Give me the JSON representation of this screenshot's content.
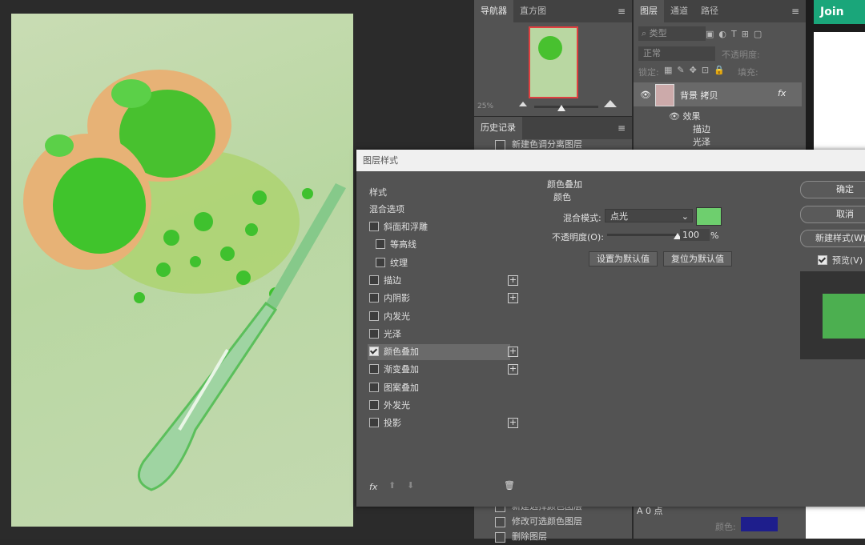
{
  "navigator": {
    "tabs": [
      "导航器",
      "直方图"
    ],
    "zoom": "25%"
  },
  "layers": {
    "tabs": [
      "图层",
      "通道",
      "路径"
    ],
    "filter_placeholder": "类型",
    "blend_mode": "正常",
    "opacity_label": "不透明度:",
    "lock_label": "锁定:",
    "fill_label": "填充:",
    "layer_name": "背景 拷贝",
    "fx_badge": "fx",
    "effects_label": "效果",
    "effect_items": [
      "描边",
      "光泽"
    ]
  },
  "history": {
    "tab": "历史记录",
    "items": [
      "新建色调分离图层",
      "新建选择颜色图层",
      "修改可选颜色图层",
      "删除图层"
    ]
  },
  "join_button": {
    "label": "Join",
    "color": "#1aa67a"
  },
  "dialog": {
    "title": "图层样式",
    "left_header": "样式",
    "blend_options": "混合选项",
    "styles": [
      {
        "label": "斜面和浮雕",
        "checked": false,
        "plus": false,
        "indent": false
      },
      {
        "label": "等高线",
        "checked": false,
        "plus": false,
        "indent": true
      },
      {
        "label": "纹理",
        "checked": false,
        "plus": false,
        "indent": true
      },
      {
        "label": "描边",
        "checked": false,
        "plus": true,
        "indent": false
      },
      {
        "label": "内阴影",
        "checked": false,
        "plus": true,
        "indent": false
      },
      {
        "label": "内发光",
        "checked": false,
        "plus": false,
        "indent": false
      },
      {
        "label": "光泽",
        "checked": false,
        "plus": false,
        "indent": false
      },
      {
        "label": "颜色叠加",
        "checked": true,
        "plus": true,
        "indent": false
      },
      {
        "label": "渐变叠加",
        "checked": false,
        "plus": true,
        "indent": false
      },
      {
        "label": "图案叠加",
        "checked": false,
        "plus": false,
        "indent": false
      },
      {
        "label": "外发光",
        "checked": false,
        "plus": false,
        "indent": false
      },
      {
        "label": "投影",
        "checked": false,
        "plus": true,
        "indent": false
      }
    ],
    "fx_label": "fx",
    "section_title": "颜色叠加",
    "section_sub": "颜色",
    "blend_mode_label": "混合模式:",
    "blend_mode_value": "点光",
    "overlay_color": "#6ecf6e",
    "opacity_label": "不透明度(O):",
    "opacity_value": "100",
    "opacity_unit": "%",
    "opacity_fraction": 1.0,
    "set_default": "设置为默认值",
    "reset_default": "复位为默认值",
    "ok": "确定",
    "cancel": "取消",
    "new_style": "新建样式(W)...",
    "preview_label": "预览(V)",
    "preview_checked": true,
    "preview_swatch_color": "#4caf50"
  },
  "bottom_props": {
    "tracking": "0 点",
    "color_label": "颜色:",
    "color_value": "#1e1e8c"
  }
}
